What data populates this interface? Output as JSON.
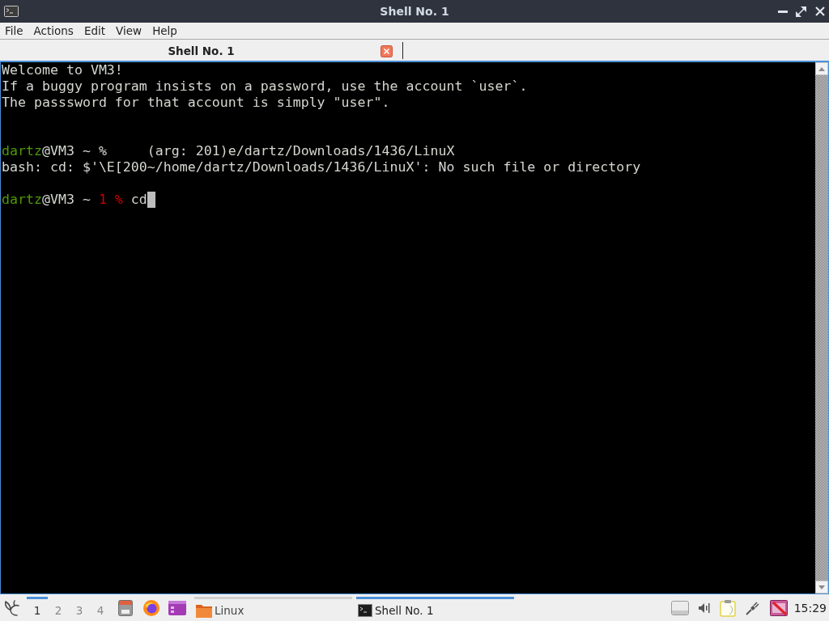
{
  "window": {
    "title": "Shell No. 1"
  },
  "menu": [
    "File",
    "Actions",
    "Edit",
    "View",
    "Help"
  ],
  "tabs": [
    {
      "label": "Shell No. 1",
      "selected": true
    }
  ],
  "terminal": {
    "lines": [
      {
        "kind": "text",
        "cursor": false,
        "segments": [
          {
            "kind": "plain",
            "text": "Welcome to VM3!"
          }
        ]
      },
      {
        "kind": "text",
        "cursor": false,
        "segments": [
          {
            "kind": "plain",
            "text": "If a buggy program insists on a password, use the account `user`."
          }
        ]
      },
      {
        "kind": "text",
        "cursor": false,
        "segments": [
          {
            "kind": "plain",
            "text": "The passsword for that account is simply \"user\"."
          }
        ]
      },
      {
        "kind": "blank"
      },
      {
        "kind": "blank"
      },
      {
        "kind": "text",
        "cursor": false,
        "segments": [
          {
            "kind": "user",
            "text": "dartz"
          },
          {
            "kind": "plain",
            "text": "@VM3 ~ %     (arg: 201)e/dartz/Downloads/1436/LinuX"
          }
        ]
      },
      {
        "kind": "text",
        "cursor": false,
        "segments": [
          {
            "kind": "plain",
            "text": "bash: cd: $'\\E[200~/home/dartz/Downloads/1436/LinuX': No such file or directory"
          }
        ]
      },
      {
        "kind": "blank"
      },
      {
        "kind": "text",
        "cursor": true,
        "segments": [
          {
            "kind": "user",
            "text": "dartz"
          },
          {
            "kind": "plain",
            "text": "@VM3 ~ "
          },
          {
            "kind": "status",
            "text": "1 %"
          },
          {
            "kind": "plain",
            "text": " cd"
          }
        ]
      }
    ]
  },
  "taskbar": {
    "desktops": [
      {
        "label": "1",
        "selected": true
      },
      {
        "label": "2",
        "selected": false
      },
      {
        "label": "3",
        "selected": false
      },
      {
        "label": "4",
        "selected": false
      }
    ],
    "tasks": [
      {
        "kind": "folder",
        "label": "Linux",
        "selected": false
      },
      {
        "kind": "terminal",
        "label": "Shell No. 1",
        "selected": true
      }
    ],
    "clock": "15:29"
  }
}
